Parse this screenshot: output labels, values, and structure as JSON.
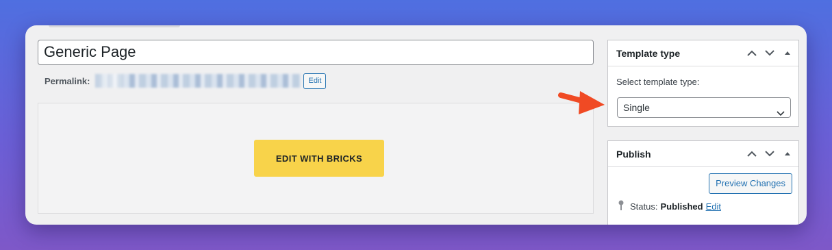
{
  "editor": {
    "title_value": "Generic Page",
    "permalink_label": "Permalink:",
    "permalink_edit": "Edit",
    "bricks_button": "EDIT WITH BRICKS"
  },
  "template_box": {
    "title": "Template type",
    "select_label": "Select template type:",
    "selected_option": "Single"
  },
  "publish_box": {
    "title": "Publish",
    "preview_button": "Preview Changes",
    "status_label": "Status:",
    "status_value": "Published",
    "status_edit": "Edit"
  },
  "colors": {
    "accent": "#2271b1",
    "bricks": "#f8d34a",
    "arrow": "#f04a24"
  },
  "icons": [
    "chevron-up-icon",
    "chevron-down-icon",
    "caret-up-icon",
    "pin-icon",
    "arrow-icon"
  ]
}
